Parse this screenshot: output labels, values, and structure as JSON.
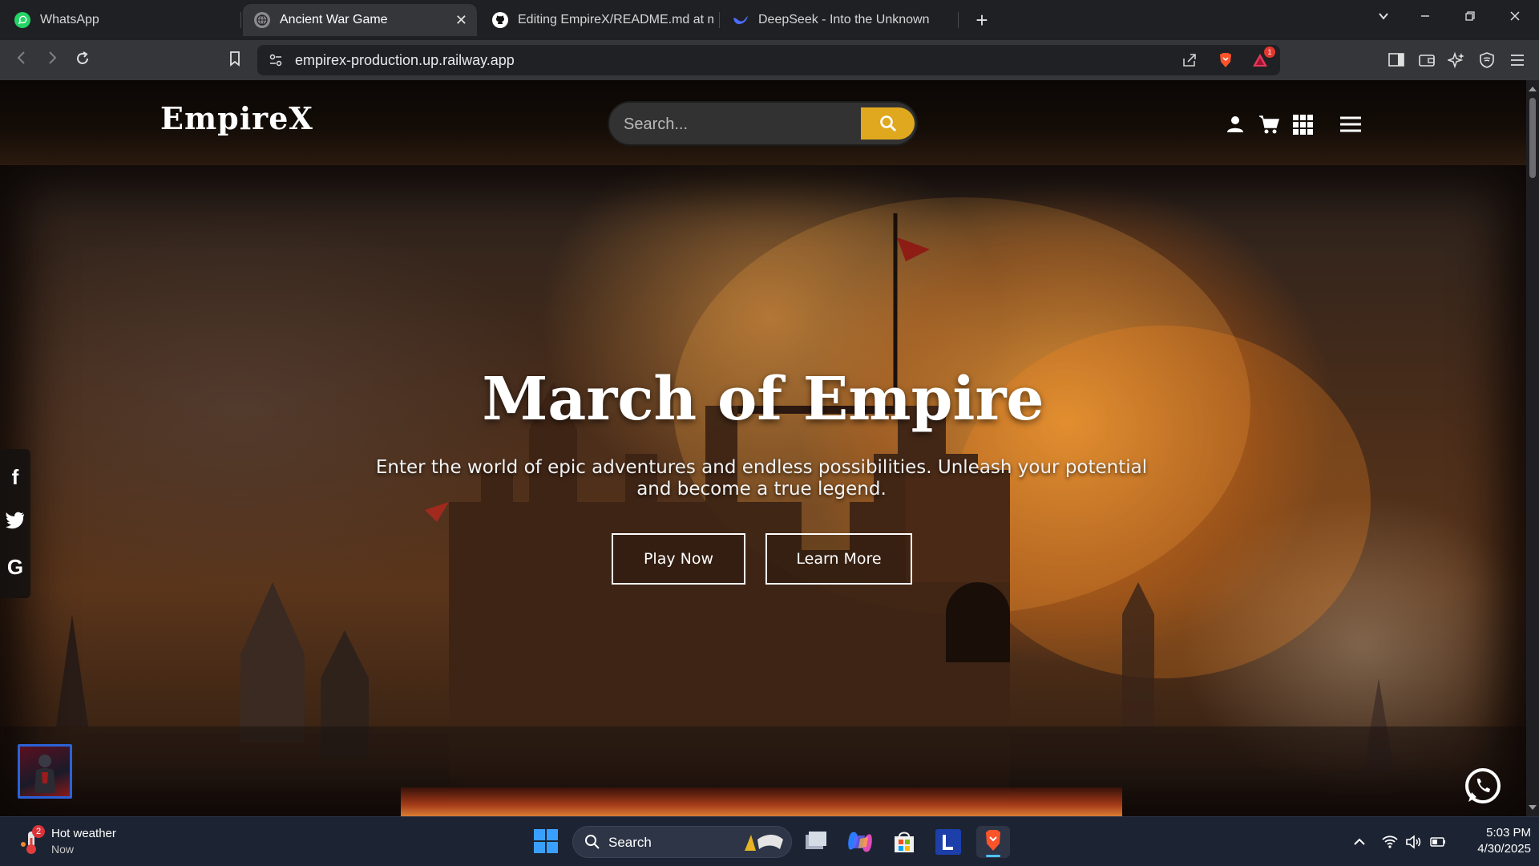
{
  "browser": {
    "tabs": [
      {
        "title": "WhatsApp",
        "active": false,
        "favicon": "whatsapp-icon"
      },
      {
        "title": "Ancient War Game",
        "active": true,
        "favicon": "globe-icon"
      },
      {
        "title": "Editing EmpireX/README.md at ma",
        "active": false,
        "favicon": "github-icon"
      },
      {
        "title": "DeepSeek - Into the Unknown",
        "active": false,
        "favicon": "deepseek-icon"
      }
    ],
    "close_glyph": "✕",
    "new_tab_glyph": "+",
    "url": "empirex-production.up.railway.app",
    "notification_count": "1"
  },
  "site": {
    "logo": "EmpireX",
    "search_placeholder": "Search...",
    "header_icons": [
      "user-icon",
      "cart-icon",
      "grid-icon",
      "menu-icon"
    ]
  },
  "hero": {
    "title": "March of Empire",
    "subtitle": "Enter the world of epic adventures and endless possibilities. Unleash your potential and become a true legend.",
    "play_label": "Play Now",
    "learn_label": "Learn More"
  },
  "social": [
    {
      "name": "facebook-icon",
      "glyph": "f"
    },
    {
      "name": "twitter-icon",
      "glyph": "🐦"
    },
    {
      "name": "google-icon",
      "glyph": "G"
    }
  ],
  "taskbar": {
    "weather_title": "Hot weather",
    "weather_sub": "Now",
    "weather_badge": "2",
    "search_label": "Search",
    "time": "5:03 PM",
    "date": "4/30/2025"
  },
  "colors": {
    "accent": "#e0a81e",
    "tab_active": "#35363a",
    "taskbar": "#1c2433"
  }
}
